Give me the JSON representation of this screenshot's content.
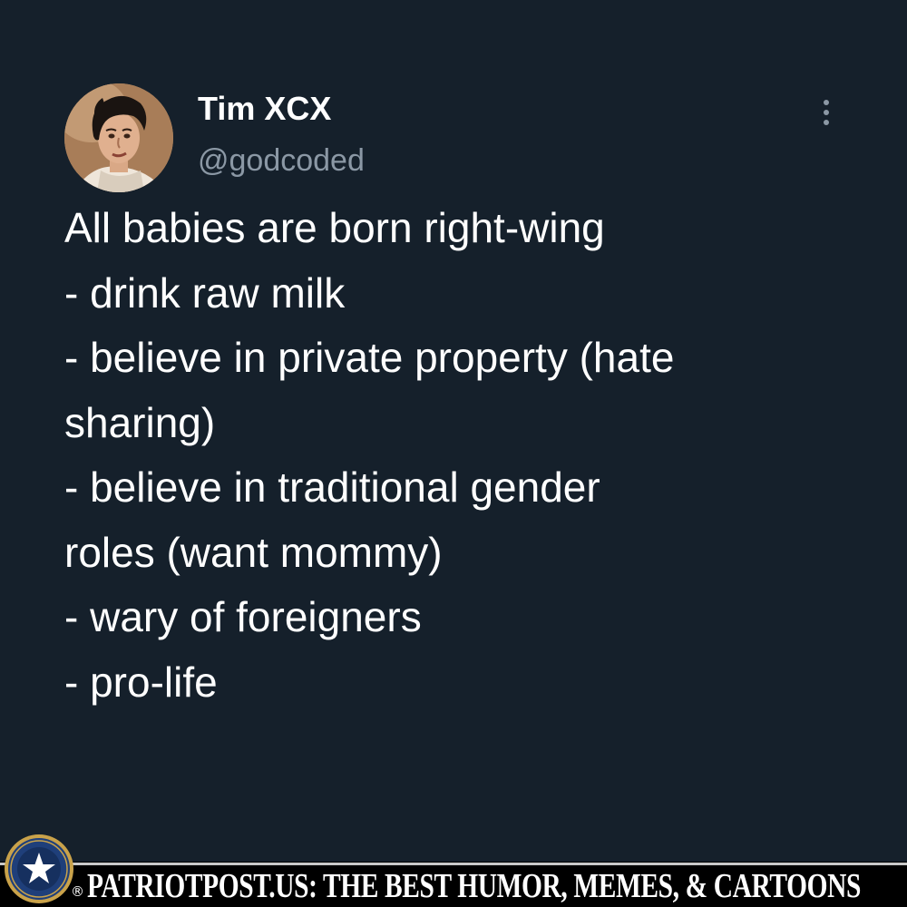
{
  "tweet": {
    "author": {
      "display_name": "Tim XCX",
      "handle": "@godcoded",
      "avatar_icon": "painted-portrait-avatar"
    },
    "more_icon": "more-vertical-icon",
    "lines": [
      "All babies are born right-wing",
      "- drink raw milk",
      "- believe in private property (hate",
      "sharing)",
      "- believe in traditional gender",
      "roles (want mommy)",
      "- wary of foreigners",
      "- pro-life"
    ]
  },
  "watermark": {
    "logo_icon": "star-seal-logo",
    "registered_mark": "®",
    "text": "PATRIOTPOST.US: THE BEST HUMOR, MEMES, & CARTOONS"
  },
  "colors": {
    "background": "#15202b",
    "primary_text": "#ffffff",
    "secondary_text": "#8b98a5",
    "footer_background": "#000000",
    "seal_blue": "#1f3f7a",
    "seal_gold": "#c9a24a"
  }
}
